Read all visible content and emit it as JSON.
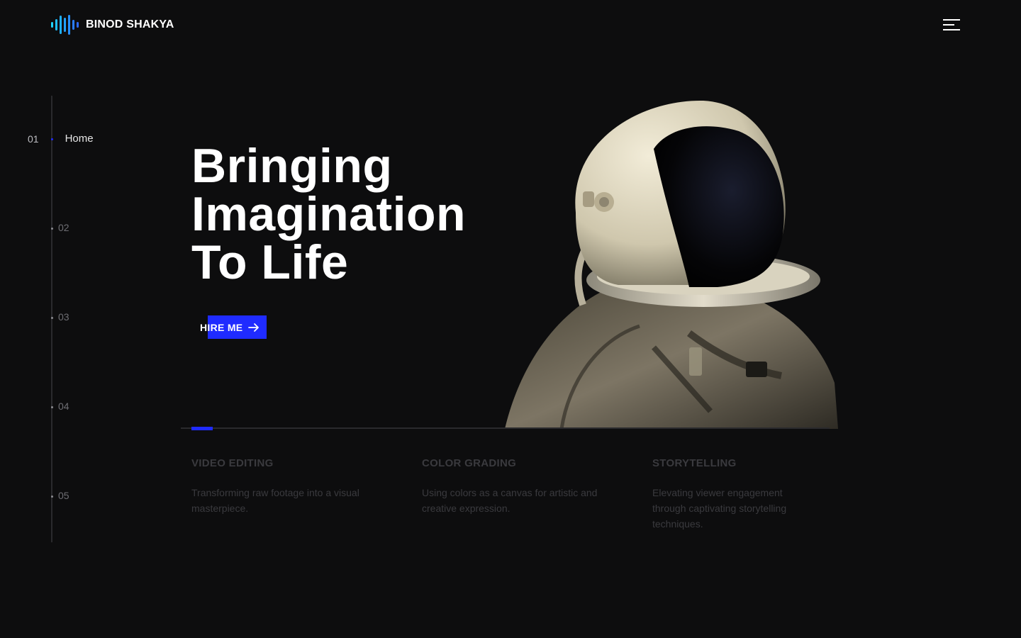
{
  "brand": {
    "name": "BINOD SHAKYA",
    "icon": "sound-wave-icon"
  },
  "menu": {
    "icon": "hamburger-menu-icon"
  },
  "side_nav": [
    {
      "num": "01",
      "label": "Home",
      "active": true
    },
    {
      "num": "02",
      "label": "",
      "active": false
    },
    {
      "num": "03",
      "label": "",
      "active": false
    },
    {
      "num": "04",
      "label": "",
      "active": false
    },
    {
      "num": "05",
      "label": "",
      "active": false
    }
  ],
  "hero": {
    "title_lines": [
      "Bringing",
      "Imagination",
      "To Life"
    ],
    "cta_label": "HIRE ME",
    "cta_icon": "arrow-right-icon"
  },
  "services": [
    {
      "title": "VIDEO EDITING",
      "desc": "Transforming raw footage into a visual masterpiece."
    },
    {
      "title": "COLOR GRADING",
      "desc": "Using colors as a canvas for artistic and creative expression."
    },
    {
      "title": "STORYTELLING",
      "desc": "Elevating viewer engagement through captivating storytelling techniques."
    }
  ],
  "colors": {
    "background": "#0d0d0e",
    "accent": "#1f2bff",
    "logo_gradient_start": "#1fd3ff",
    "logo_gradient_end": "#2b6bff",
    "muted_text": "#3a3a3e"
  }
}
